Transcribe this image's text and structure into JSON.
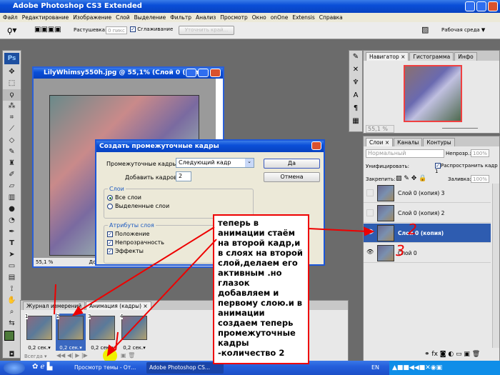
{
  "app": {
    "title": "Adobe Photoshop CS3 Extended",
    "ps_label": "Ps"
  },
  "menu": [
    "Файл",
    "Редактирование",
    "Изображение",
    "Слой",
    "Выделение",
    "Фильтр",
    "Анализ",
    "Просмотр",
    "Окно",
    "onOne",
    "Extensis",
    "Справка"
  ],
  "options": {
    "feather_label": "Растушевка:",
    "feather_value": "0 пикс",
    "antialias_label": "Сглаживание",
    "refine_edge": "Уточнить край...",
    "workspace": "Рабочая среда ▼"
  },
  "document": {
    "title": "LilyWhimsy550h.jpg @ 55,1% (Слой 0 (коп...",
    "zoom": "55,1 %",
    "status": "Док"
  },
  "dialog": {
    "title": "Создать промежуточные кадры",
    "tween_label": "Промежуточные кадры:",
    "tween_value": "Следующий кадр",
    "add_frames_label": "Добавить кадров:",
    "add_frames_value": "2",
    "ok": "Да",
    "cancel": "Отмена",
    "layers_group": "Слои",
    "all_layers": "Все слои",
    "selected_layers": "Выделенные слои",
    "attrs_group": "Атрибуты слоя",
    "position": "Положение",
    "opacity": "Непрозрачность",
    "effects": "Эффекты"
  },
  "note": "теперь в анимации стаём на второй кадр,и в слоях на второй слой,делаем его активным .но глазок добавляем и первому слою.и в анимации создаем теперь промежуточные кадры -количество 2",
  "navigator": {
    "tabs": [
      "Навигатор ×",
      "Гистограмма",
      "Инфо"
    ],
    "zoom": "55,1 %"
  },
  "layers_panel": {
    "tabs": [
      "Слои ×",
      "Каналы",
      "Контуры"
    ],
    "blend_mode": "Нормальный",
    "opacity_label": "Непрозр.:",
    "opacity_value": "100%",
    "unify_label": "Унифицировать:",
    "propagate_label": "Распространить кадр 1",
    "lock_label": "Закрепить:",
    "fill_label": "Заливка:",
    "fill_value": "100%",
    "layers": [
      {
        "name": "Слой 0 (копия) 3",
        "visible": false,
        "selected": false
      },
      {
        "name": "Слой 0 (копия) 2",
        "visible": false,
        "selected": false
      },
      {
        "name": "Слой 0 (копия)",
        "visible": true,
        "selected": true
      },
      {
        "name": "Слой 0",
        "visible": true,
        "selected": false
      }
    ],
    "annotations": [
      "2",
      "3"
    ]
  },
  "animation": {
    "tabs": [
      "Журнал измерений",
      "Анимация (кадры) ×"
    ],
    "frames": [
      {
        "n": "1",
        "delay": "0,2 сек.▾"
      },
      {
        "n": "2",
        "delay": "0,2 сек.▾"
      },
      {
        "n": "3",
        "delay": "0,2 сек.▾"
      },
      {
        "n": "4",
        "delay": "0,2 сек.▾"
      }
    ],
    "loop": "Всегда ▾"
  },
  "taskbar": {
    "tasks": [
      "Просмотр темы - От...",
      "Adobe Photoshop CS..."
    ],
    "lang": "EN"
  },
  "colors": {
    "accent": "#2e5cb0",
    "annotation": "#e00000",
    "highlight": "#f0f000"
  }
}
